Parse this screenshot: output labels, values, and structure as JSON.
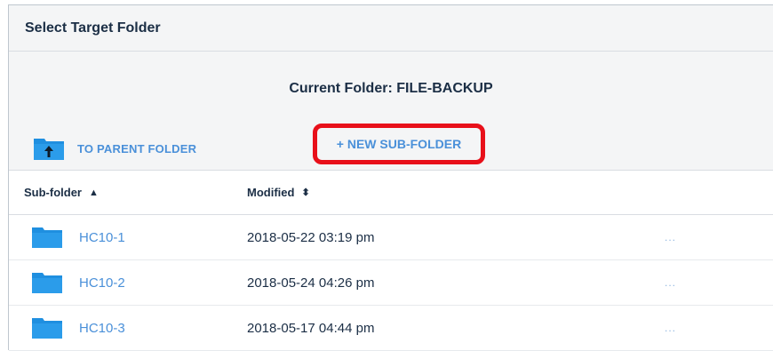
{
  "dialog": {
    "title": "Select Target Folder",
    "current_folder_text": "Current Folder: FILE-BACKUP",
    "to_parent_label": "TO PARENT FOLDER",
    "new_subfolder_label": "+ NEW SUB-FOLDER"
  },
  "table": {
    "headers": {
      "subfolder": "Sub-folder",
      "modified": "Modified"
    },
    "sort_icons": {
      "subfolder": "▲",
      "modified": "⬍"
    },
    "rows": [
      {
        "name": "HC10-1",
        "modified": "2018-05-22 03:19 pm",
        "menu": "..."
      },
      {
        "name": "HC10-2",
        "modified": "2018-05-24 04:26 pm",
        "menu": "..."
      },
      {
        "name": "HC10-3",
        "modified": "2018-05-17 04:44 pm",
        "menu": "..."
      }
    ]
  },
  "colors": {
    "link": "#4a90d9",
    "folder": "#1f8fe0",
    "highlight": "#e8101a"
  }
}
